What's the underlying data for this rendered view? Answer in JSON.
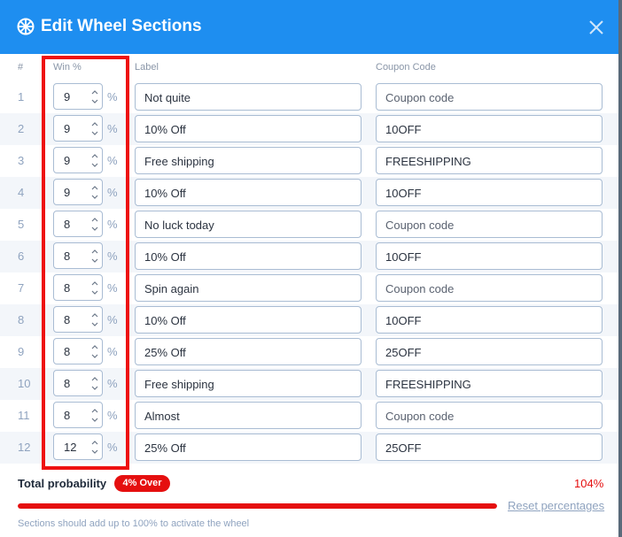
{
  "modal": {
    "title": "Edit Wheel Sections",
    "close_icon": "close-icon",
    "wheel_icon": "wheel-icon"
  },
  "columns": {
    "number": "#",
    "win": "Win %",
    "label": "Label",
    "coupon": "Coupon Code"
  },
  "percent_symbol": "%",
  "sections": [
    {
      "num": "1",
      "win": "9",
      "label": "Not quite",
      "coupon": "Coupon code",
      "coupon_is_placeholder": true
    },
    {
      "num": "2",
      "win": "9",
      "label": "10% Off",
      "coupon": "10OFF",
      "coupon_is_placeholder": false
    },
    {
      "num": "3",
      "win": "9",
      "label": "Free shipping",
      "coupon": "FREESHIPPING",
      "coupon_is_placeholder": false
    },
    {
      "num": "4",
      "win": "9",
      "label": "10% Off",
      "coupon": "10OFF",
      "coupon_is_placeholder": false
    },
    {
      "num": "5",
      "win": "8",
      "label": "No luck today",
      "coupon": "Coupon code",
      "coupon_is_placeholder": true
    },
    {
      "num": "6",
      "win": "8",
      "label": "10% Off",
      "coupon": "10OFF",
      "coupon_is_placeholder": false
    },
    {
      "num": "7",
      "win": "8",
      "label": "Spin again",
      "coupon": "Coupon code",
      "coupon_is_placeholder": true
    },
    {
      "num": "8",
      "win": "8",
      "label": "10% Off",
      "coupon": "10OFF",
      "coupon_is_placeholder": false
    },
    {
      "num": "9",
      "win": "8",
      "label": "25% Off",
      "coupon": "25OFF",
      "coupon_is_placeholder": false
    },
    {
      "num": "10",
      "win": "8",
      "label": "Free shipping",
      "coupon": "FREESHIPPING",
      "coupon_is_placeholder": false
    },
    {
      "num": "11",
      "win": "8",
      "label": "Almost",
      "coupon": "Coupon code",
      "coupon_is_placeholder": true
    },
    {
      "num": "12",
      "win": "12",
      "label": "25% Off",
      "coupon": "25OFF",
      "coupon_is_placeholder": false
    }
  ],
  "footer": {
    "total_label": "Total probability",
    "badge": "4% Over",
    "total_value": "104%",
    "progress_percent": 104,
    "reset_label": "Reset percentages",
    "hint": "Sections should add up to 100% to activate the wheel"
  },
  "colors": {
    "header": "#1e8ef0",
    "error": "#e50f0f",
    "highlight_box": "#ee1111",
    "muted_text": "#8fa3bf",
    "row_alt": "#f3f6fa"
  }
}
